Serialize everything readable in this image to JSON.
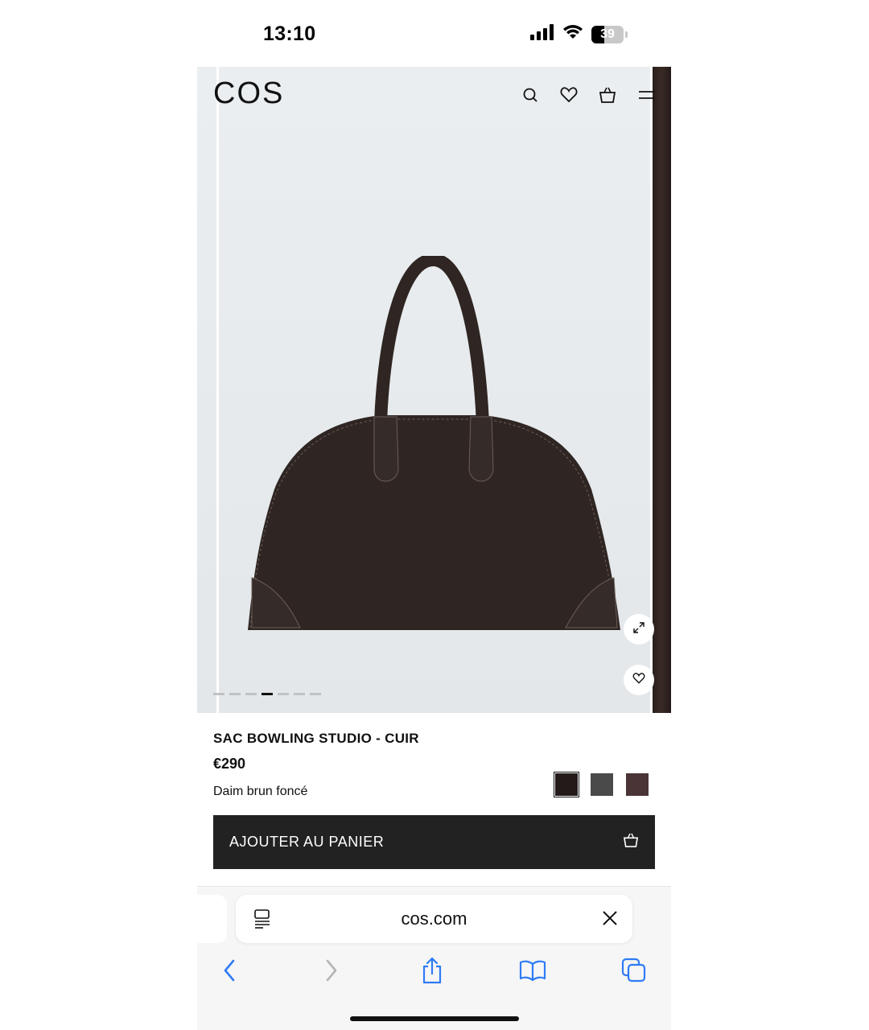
{
  "status_bar": {
    "time": "13:10",
    "battery": "39",
    "battery_level": 0.39,
    "icons": [
      "cellular-signal-icon",
      "wifi-icon",
      "battery-icon"
    ]
  },
  "header": {
    "logo": "COS",
    "icons": [
      "search-icon",
      "heart-icon",
      "shopping-bag-icon",
      "menu-icon"
    ]
  },
  "gallery": {
    "slide_count": 7,
    "active_slide": 4,
    "buttons": [
      "expand-icon",
      "heart-icon"
    ]
  },
  "product": {
    "title": "SAC BOWLING STUDIO - CUIR",
    "price": "€290",
    "color_name": "Daim brun foncé",
    "swatches": [
      {
        "color": "#231a1a",
        "selected": true
      },
      {
        "color": "#4a4a4a",
        "selected": false
      },
      {
        "color": "#4a3436",
        "selected": false
      }
    ]
  },
  "cart_button": {
    "label": "AJOUTER AU PANIER",
    "icon": "shopping-bag-icon"
  },
  "browser": {
    "url": "cos.com",
    "toolbar": [
      "back-icon",
      "forward-icon",
      "share-icon",
      "bookmarks-icon",
      "tabs-icon"
    ],
    "accent": "#2f7bf6"
  }
}
